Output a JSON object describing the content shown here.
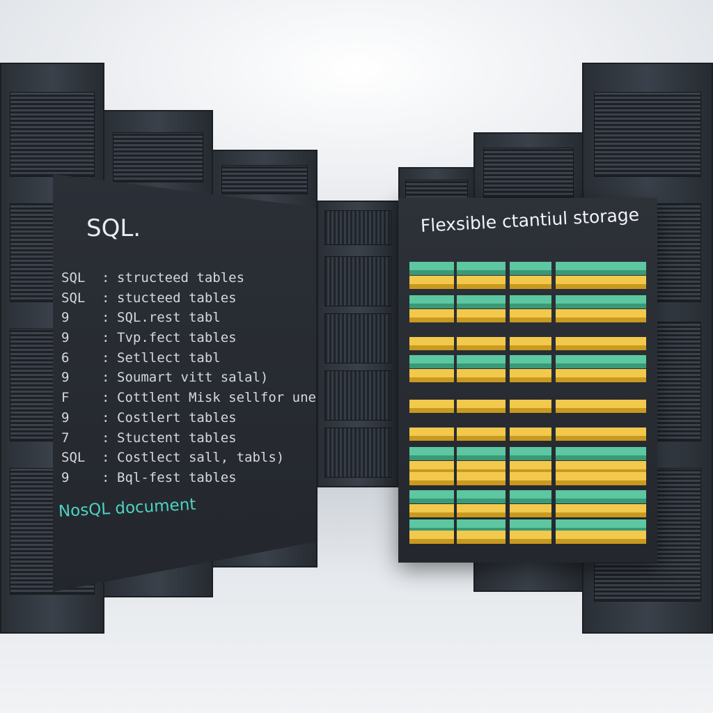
{
  "sql_panel": {
    "title": "SQL.",
    "rows": [
      {
        "key": "SQL",
        "sep": ":",
        "text": "structeed tables"
      },
      {
        "key": "SQL",
        "sep": ":",
        "text": "stucteed tables"
      },
      {
        "key": "9",
        "sep": ":",
        "text": "SQL.rest tabl"
      },
      {
        "key": "9",
        "sep": ":",
        "text": "Tvp.fect tables"
      },
      {
        "key": "6",
        "sep": ":",
        "text": "Setllect tabl"
      },
      {
        "key": "9",
        "sep": ":",
        "text": "Soumart vitt salal)"
      },
      {
        "key": "F",
        "sep": ":",
        "text": "Cottlent Misk sellfor unents"
      },
      {
        "key": "9",
        "sep": ":",
        "text": "Costlert tables"
      },
      {
        "key": "7",
        "sep": ":",
        "text": "Stuctent tables"
      },
      {
        "key": "SQL",
        "sep": ":",
        "text": "Costlect sall, tabls)"
      },
      {
        "key": "9",
        "sep": ":",
        "text": "Bql-fest tables"
      }
    ],
    "footer": "NosQL document",
    "footer_color": "#4fd3c1"
  },
  "flex_panel": {
    "title": "Flexsible ctantiul storage",
    "colors": {
      "yellow": "#f2c94c",
      "yellow_dark": "#c99a1f",
      "teal": "#5cc7a0",
      "teal_dark": "#3a9a77"
    }
  }
}
